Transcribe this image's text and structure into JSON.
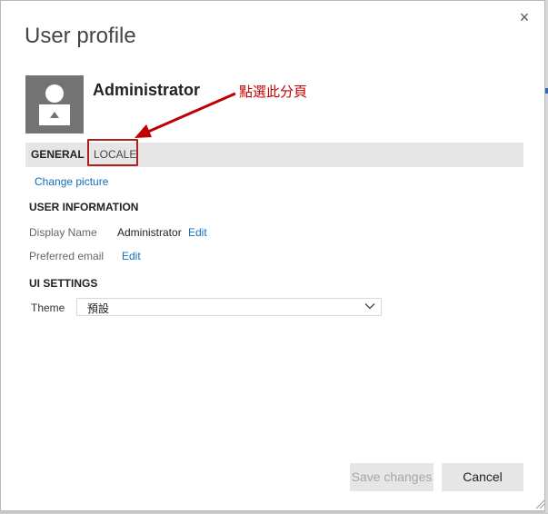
{
  "dialog": {
    "title": "User profile",
    "close_glyph": "×"
  },
  "profile": {
    "name": "Administrator",
    "change_picture": "Change picture"
  },
  "annotation": {
    "text": "點選此分頁",
    "color": "#c00000"
  },
  "tabs": [
    {
      "label": "GENERAL",
      "active": true
    },
    {
      "label": "LOCALE",
      "active": false
    }
  ],
  "user_information": {
    "heading": "USER INFORMATION",
    "display_name_label": "Display Name",
    "display_name_value": "Administrator",
    "display_name_edit": "Edit",
    "preferred_email_label": "Preferred email",
    "preferred_email_edit": "Edit"
  },
  "ui_settings": {
    "heading": "UI SETTINGS",
    "theme_label": "Theme",
    "theme_value": "預設"
  },
  "buttons": {
    "save": "Save changes",
    "cancel": "Cancel"
  },
  "colors": {
    "link": "#106ebe",
    "tabbar": "#e6e6e6",
    "highlight_box": "#b02020",
    "avatar": "#737373"
  }
}
